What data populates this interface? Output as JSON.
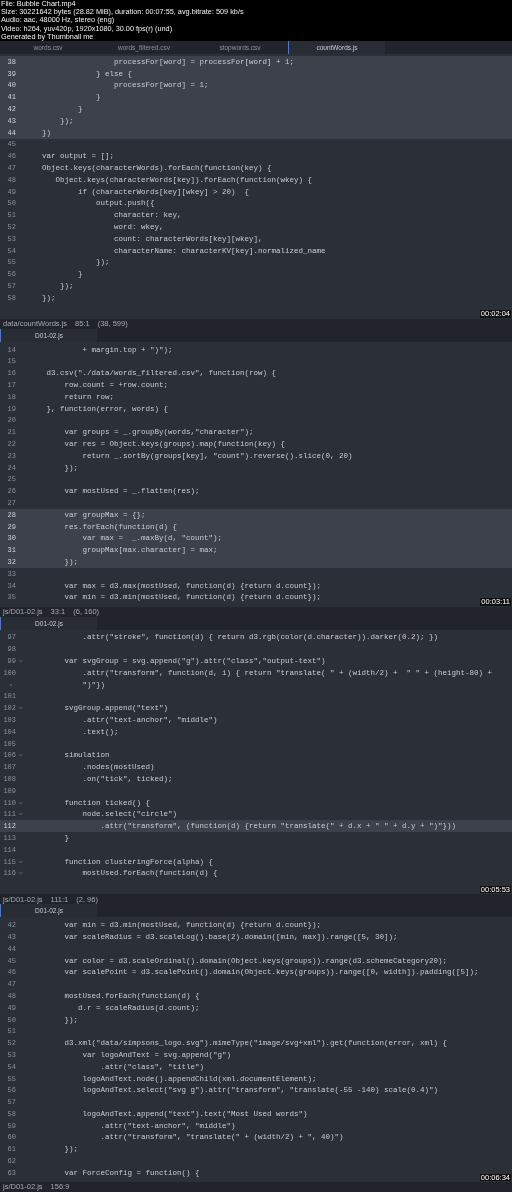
{
  "info": [
    "File: Bubble Chart.mp4",
    "Size: 30221642 bytes (28.82 MiB), duration: 00:07:55, avg.bitrate: 509 kb/s",
    "Audio: aac, 48000 Hz, stereo (eng)",
    "Video: h264, yuv420p, 1920x1080, 30.00 fps(r) (und)",
    "Generated by Thumbnail me"
  ],
  "frames": [
    {
      "tabs": [
        {
          "label": "words.csv",
          "selected": false
        },
        {
          "label": "words_filtered.csv",
          "selected": false
        },
        {
          "label": "stopwords.csv",
          "selected": false
        },
        {
          "label": "countWords.js",
          "selected": true
        }
      ],
      "lines": [
        {
          "number": "38",
          "text": "                    processFor[word] = processFor[word] + 1;",
          "highlighted": true,
          "fold": false
        },
        {
          "number": "39",
          "text": "                } else {",
          "highlighted": true,
          "fold": false
        },
        {
          "number": "40",
          "text": "                    processFor[word] = 1;",
          "highlighted": true,
          "fold": false
        },
        {
          "number": "41",
          "text": "                }",
          "highlighted": true,
          "fold": false
        },
        {
          "number": "42",
          "text": "            }",
          "highlighted": true,
          "fold": false
        },
        {
          "number": "43",
          "text": "        });",
          "highlighted": true,
          "fold": false
        },
        {
          "number": "44",
          "text": "    })",
          "highlighted": true,
          "fold": false
        },
        {
          "number": "45",
          "highlighted": false,
          "fold": false
        },
        {
          "number": "46",
          "text": "    var output = [];",
          "highlighted": false,
          "fold": false
        },
        {
          "number": "47",
          "text": "    Object.keys(characterWords).forEach(function(key) {",
          "highlighted": false,
          "fold": false
        },
        {
          "number": "48",
          "text": "       Object.keys(characterWords[key]).forEach(function(wkey) {",
          "highlighted": false,
          "fold": false
        },
        {
          "number": "49",
          "text": "            if (characterWords[key][wkey] > 20)  {",
          "highlighted": false,
          "fold": false
        },
        {
          "number": "50",
          "text": "                output.push({",
          "highlighted": false,
          "fold": false
        },
        {
          "number": "51",
          "text": "                    character: key,",
          "highlighted": false,
          "fold": false
        },
        {
          "number": "52",
          "text": "                    word: wkey,",
          "highlighted": false,
          "fold": false
        },
        {
          "number": "53",
          "text": "                    count: characterWords[key][wkey],",
          "highlighted": false,
          "fold": false
        },
        {
          "number": "54",
          "text": "                    characterName: characterKV[key].normalized_name",
          "highlighted": false,
          "fold": false
        },
        {
          "number": "55",
          "text": "                });",
          "highlighted": false,
          "fold": false
        },
        {
          "number": "56",
          "text": "            }",
          "highlighted": false,
          "fold": false
        },
        {
          "number": "57",
          "text": "        });",
          "highlighted": false,
          "fold": false
        },
        {
          "number": "58",
          "text": "    });",
          "highlighted": false,
          "fold": false
        }
      ],
      "status": [
        "data/countWords.js",
        "85:1",
        "(38, 599)"
      ],
      "timestamp": "00:02:04"
    },
    {
      "tabs": [
        {
          "label": "D01-02.js",
          "selected": true
        }
      ],
      "lines": [
        {
          "number": "14",
          "text": "             + margin.top + \")\");",
          "highlighted": false,
          "fold": false
        },
        {
          "number": "15",
          "highlighted": false,
          "fold": false
        },
        {
          "number": "16",
          "text": "     d3.csv(\"./data/words_filtered.csv\", function(row) {",
          "highlighted": false,
          "fold": false
        },
        {
          "number": "17",
          "text": "         row.count = +row.count;",
          "highlighted": false,
          "fold": false
        },
        {
          "number": "18",
          "text": "         return row;",
          "highlighted": false,
          "fold": false
        },
        {
          "number": "19",
          "text": "     }, function(error, words) {",
          "highlighted": false,
          "fold": false
        },
        {
          "number": "20",
          "highlighted": false,
          "fold": false
        },
        {
          "number": "21",
          "text": "         var groups = _.groupBy(words,\"character\");",
          "highlighted": false,
          "fold": false
        },
        {
          "number": "22",
          "text": "         var res = Object.keys(groups).map(function(key) {",
          "highlighted": false,
          "fold": false
        },
        {
          "number": "23",
          "text": "             return _.sortBy(groups[key], \"count\").reverse().slice(0, 20)",
          "highlighted": false,
          "fold": false
        },
        {
          "number": "24",
          "text": "         });",
          "highlighted": false,
          "fold": false
        },
        {
          "number": "25",
          "highlighted": false,
          "fold": false
        },
        {
          "number": "26",
          "text": "         var mostUsed = _.flatten(res);",
          "highlighted": false,
          "fold": false
        },
        {
          "number": "27",
          "highlighted": false,
          "fold": false
        },
        {
          "number": "28",
          "text": "         var groupMax = {};",
          "highlighted": true,
          "fold": false
        },
        {
          "number": "29",
          "text": "         res.forEach(function(d) {",
          "highlighted": true,
          "fold": false
        },
        {
          "number": "30",
          "text": "             var max =  _.maxBy(d, \"count\");",
          "highlighted": true,
          "fold": false
        },
        {
          "number": "31",
          "text": "             groupMax[max.character] = max;",
          "highlighted": true,
          "fold": false
        },
        {
          "number": "32",
          "text": "         });",
          "highlighted": true,
          "fold": false
        },
        {
          "number": "33",
          "highlighted": false,
          "fold": false
        },
        {
          "number": "34",
          "text": "         var max = d3.max(mostUsed, function(d) {return d.count});",
          "highlighted": false,
          "fold": false
        },
        {
          "number": "35",
          "text": "         var min = d3.min(mostUsed, function(d) {return d.count});",
          "highlighted": false,
          "fold": false
        }
      ],
      "status": [
        "js/D01-02.js",
        "33:1",
        "(6, 160)"
      ],
      "timestamp": "00:03:11"
    },
    {
      "tabs": [
        {
          "label": "D01-02.js",
          "selected": true
        }
      ],
      "lines": [
        {
          "number": "97",
          "text": "             .attr(\"stroke\", function(d) { return d3.rgb(color(d.character)).darker(0.2); })",
          "highlighted": false,
          "fold": false
        },
        {
          "number": "98",
          "highlighted": false,
          "fold": false
        },
        {
          "number": "99",
          "text": "         var svgGroup = svg.append(\"g\").attr(\"class\",\"output-text\")",
          "highlighted": false,
          "fold": true
        },
        {
          "number": "100",
          "text": "             .attr(\"transform\", function(d, i) { return \"translate( \" + (width/2) +  \" \" + (height-80) +",
          "highlighted": false,
          "fold": false
        },
        {
          "kind": "wrap",
          "text": "             \")\"})",
          "highlighted": false,
          "fold": false
        },
        {
          "number": "101",
          "highlighted": false,
          "fold": false
        },
        {
          "number": "102",
          "text": "         svgGroup.append(\"text\")",
          "highlighted": false,
          "fold": true
        },
        {
          "number": "103",
          "text": "             .attr(\"text-anchor\", \"middle\")",
          "highlighted": false,
          "fold": false
        },
        {
          "number": "104",
          "text": "             .text();",
          "highlighted": false,
          "fold": false
        },
        {
          "number": "105",
          "highlighted": false,
          "fold": false
        },
        {
          "number": "106",
          "text": "         simulation",
          "highlighted": false,
          "fold": true
        },
        {
          "number": "107",
          "text": "             .nodes(mostUsed)",
          "highlighted": false,
          "fold": false
        },
        {
          "number": "108",
          "text": "             .on(\"tick\", ticked);",
          "highlighted": false,
          "fold": false
        },
        {
          "number": "109",
          "highlighted": false,
          "fold": false
        },
        {
          "number": "110",
          "text": "         function ticked() {",
          "highlighted": false,
          "fold": true
        },
        {
          "number": "111",
          "text": "             node.select(\"circle\")",
          "highlighted": false,
          "fold": true
        },
        {
          "number": "112",
          "text": "                 .attr(\"transform\", (function(d) {return \"translate(\" + d.x + \" \" + d.y + \")\"}))",
          "highlighted": true,
          "fold": false
        },
        {
          "number": "113",
          "text": "         }",
          "highlighted": false,
          "fold": false
        },
        {
          "number": "114",
          "highlighted": false,
          "fold": false
        },
        {
          "number": "115",
          "text": "         function clusteringForce(alpha) {",
          "highlighted": false,
          "fold": true
        },
        {
          "number": "116",
          "text": "             mostUsed.forEach(function(d) {",
          "highlighted": false,
          "fold": true
        }
      ],
      "status": [
        "js/D01-02.js",
        "111:1",
        "(2, 96)"
      ],
      "timestamp": "00:05:53"
    },
    {
      "tabs": [
        {
          "label": "D01-02.js",
          "selected": true
        }
      ],
      "lines": [
        {
          "number": "42",
          "text": "         var min = d3.min(mostUsed, function(d) {return d.count});",
          "highlighted": false,
          "fold": false
        },
        {
          "number": "43",
          "text": "         var scaleRadius = d3.scaleLog().base(2).domain([min, max]).range([5, 30]);",
          "highlighted": false,
          "fold": false
        },
        {
          "number": "44",
          "highlighted": false,
          "fold": false
        },
        {
          "number": "45",
          "text": "         var color = d3.scaleOrdinal().domain(Object.keys(groups)).range(d3.schemeCategory20);",
          "highlighted": false,
          "fold": false
        },
        {
          "number": "46",
          "text": "         var scalePoint = d3.scalePoint().domain(Object.keys(groups)).range([0, width]).padding([5]);",
          "highlighted": false,
          "fold": false
        },
        {
          "number": "47",
          "highlighted": false,
          "fold": false
        },
        {
          "number": "48",
          "text": "         mostUsed.forEach(function(d) {",
          "highlighted": false,
          "fold": false
        },
        {
          "number": "49",
          "text": "            d.r = scaleRadius(d.count);",
          "highlighted": false,
          "fold": false
        },
        {
          "number": "50",
          "text": "         });",
          "highlighted": false,
          "fold": false
        },
        {
          "number": "51",
          "highlighted": false,
          "fold": false
        },
        {
          "number": "52",
          "text": "         d3.xml(\"data/simpsons_logo.svg\").mimeType(\"image/svg+xml\").get(function(error, xml) {",
          "highlighted": false,
          "fold": false
        },
        {
          "number": "53",
          "text": "             var logoAndText = svg.append(\"g\")",
          "highlighted": false,
          "fold": false
        },
        {
          "number": "54",
          "text": "                 .attr(\"class\", \"title\")",
          "highlighted": false,
          "fold": false
        },
        {
          "number": "55",
          "text": "             logoAndText.node().appendChild(xml.documentElement);",
          "highlighted": false,
          "fold": false
        },
        {
          "number": "56",
          "text": "             logoAndText.select(\"svg g\").attr(\"transform\", \"translate(-55 -140) scale(0.4)\")",
          "highlighted": false,
          "fold": false
        },
        {
          "number": "57",
          "highlighted": false,
          "fold": false
        },
        {
          "number": "58",
          "text": "             logoAndText.append(\"text\").text(\"Most Used words\")",
          "highlighted": false,
          "fold": false
        },
        {
          "number": "59",
          "text": "                 .attr(\"text-anchor\", \"middle\")",
          "highlighted": false,
          "fold": false
        },
        {
          "number": "60",
          "text": "                 .attr(\"transform\", \"translate(\" + (width/2) + \", 40)\")",
          "highlighted": false,
          "fold": false
        },
        {
          "number": "61",
          "text": "         });",
          "highlighted": false,
          "fold": false
        },
        {
          "number": "62",
          "highlighted": false,
          "fold": false
        },
        {
          "number": "63",
          "text": "         var ForceConfig = function() {",
          "highlighted": false,
          "fold": false
        }
      ],
      "status": [
        "js/D01-02.js",
        "156:9"
      ],
      "timestamp": "00:06:34"
    }
  ]
}
